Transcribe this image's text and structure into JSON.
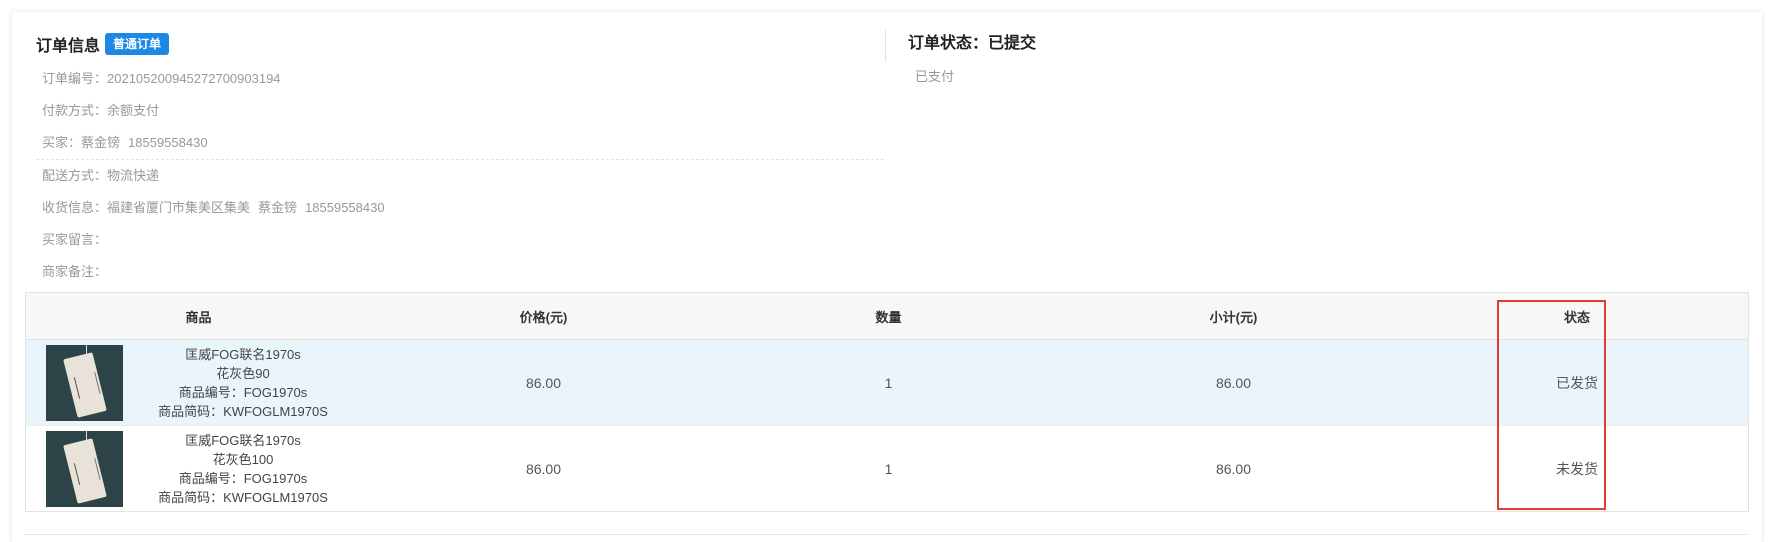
{
  "order_info": {
    "title": "订单信息",
    "badge": "普通订单",
    "order_no_label": "订单编号：",
    "order_no": "20210520094527270090319​4",
    "payment_label": "付款方式：",
    "payment": "余额支付",
    "buyer_label": "买家：",
    "buyer_name": "蔡金镑",
    "buyer_phone": "18559558430",
    "delivery_label": "配送方式：",
    "delivery": "物流快递",
    "shipping_label": "收货信息：",
    "shipping_address": "福建省厦门市集美区集美",
    "shipping_name": "蔡金镑",
    "shipping_phone": "18559558430",
    "buyer_msg_label": "买家留言：",
    "buyer_msg": "",
    "merchant_note_label": "商家备注：",
    "merchant_note": ""
  },
  "order_status": {
    "title": "订单状态：已提交",
    "payment_status": "已支付"
  },
  "table": {
    "headers": {
      "goods": "商品",
      "price": "价格(元)",
      "qty": "数量",
      "subtotal": "小计(元)",
      "status": "状态"
    },
    "rows": [
      {
        "name": "匡威FOG联名1970s",
        "spec": "花灰色90",
        "code": "商品编号：FOG1970s",
        "barcode": "商品简码：KWFOGLM1970S",
        "price": "86.00",
        "qty": "1",
        "subtotal": "86.00",
        "status": "已发货"
      },
      {
        "name": "匡威FOG联名1970s",
        "spec": "花灰色100",
        "code": "商品编号：FOG1970s",
        "barcode": "商品简码：KWFOGLM1970S",
        "price": "86.00",
        "qty": "1",
        "subtotal": "86.00",
        "status": "未发货"
      }
    ]
  },
  "colors": {
    "badge": "#1e88e5",
    "highlight_row": "#e9f4fb",
    "red_box": "#e53935"
  }
}
